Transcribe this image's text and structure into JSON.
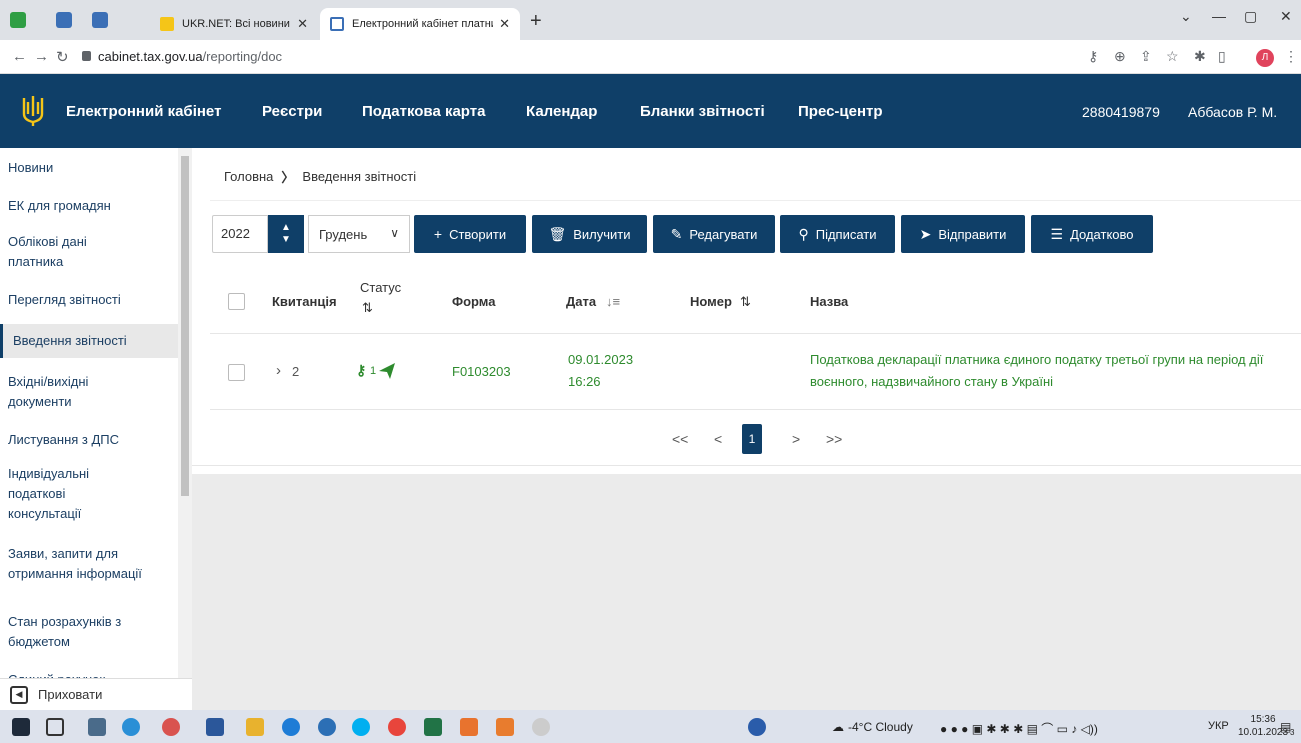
{
  "browser": {
    "tabs": [
      {
        "label": "UKR.NET: Всі новини України, ос",
        "active": false
      },
      {
        "label": "Електронний кабінет платника",
        "active": true
      }
    ],
    "new_tab_label": "+",
    "url_host": "cabinet.tax.gov.ua",
    "url_path": "/reporting/doc",
    "profile_initial": "Л"
  },
  "header": {
    "brand": "Електронний кабінет",
    "nav": [
      "Реєстри",
      "Податкова карта",
      "Календар",
      "Бланки звітності",
      "Прес-центр"
    ],
    "tax_id": "2880419879",
    "user": "Аббасов Р. М."
  },
  "sidebar": {
    "items": [
      {
        "label": "Новини",
        "active": false
      },
      {
        "label": "ЕК для громадян",
        "active": false
      },
      {
        "label": "Облікові дані платника",
        "active": false
      },
      {
        "label": "Перегляд звітності",
        "active": false
      },
      {
        "label": "Введення звітності",
        "active": true
      },
      {
        "label": "Вхідні/вихідні документи",
        "active": false
      },
      {
        "label": "Листування з ДПС",
        "active": false
      },
      {
        "label": "Індивідуальні податкові консультації",
        "active": false
      },
      {
        "label": "Заяви, запити для отримання інформації",
        "active": false
      },
      {
        "label": "Стан розрахунків з бюджетом",
        "active": false
      },
      {
        "label": "Єдиний рахунок",
        "active": false
      }
    ],
    "hide_label": "Приховати"
  },
  "breadcrumb": {
    "home": "Головна",
    "current": "Введення звітності"
  },
  "toolbar": {
    "year": "2022",
    "month": "Грудень",
    "buttons": {
      "create": "Створити",
      "delete": "Вилучити",
      "edit": "Редагувати",
      "sign": "Підписати",
      "send": "Відправити",
      "more": "Додатково"
    }
  },
  "table": {
    "headers": {
      "receipt": "Квитанція",
      "status": "Статус",
      "form": "Форма",
      "date": "Дата",
      "number": "Номер",
      "name": "Назва"
    },
    "rows": [
      {
        "receipts": "2",
        "status_count": "1",
        "form": "F0103203",
        "date": "09.01.2023",
        "time": "16:26",
        "number": "",
        "name_line1": "Податкова декларації платника єдиного податку третьої групи на період дії",
        "name_line2": "воєнного, надзвичайного стану в Україні"
      }
    ]
  },
  "pagination": {
    "first": "<<",
    "prev": "<",
    "current": "1",
    "next": ">",
    "last": ">>"
  },
  "taskbar": {
    "weather": "-4°C Cloudy",
    "lang": "УКР",
    "time": "15:36",
    "date": "10.01.2023",
    "notifications": "3"
  },
  "colors": {
    "brand": "#0f3f68",
    "accent_green": "#2e8b2e"
  }
}
